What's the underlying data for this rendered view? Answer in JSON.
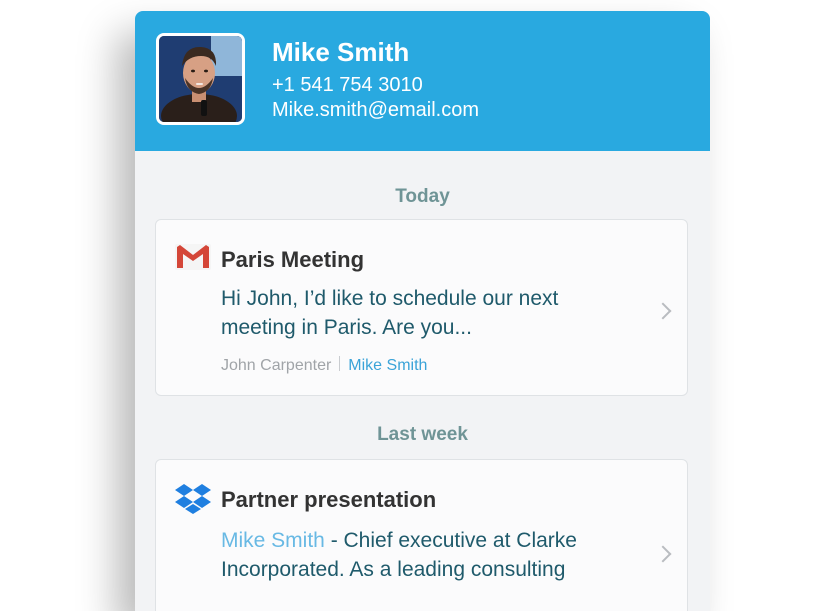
{
  "contact": {
    "name": "Mike Smith",
    "phone": "+1 541 754 3010",
    "email": "Mike.smith@email.com"
  },
  "sections": [
    {
      "label": "Today"
    },
    {
      "label": "Last week"
    }
  ],
  "cards": [
    {
      "icon": "gmail-icon",
      "title": "Paris Meeting",
      "body": "Hi John, I’d like to schedule our next meeting in Paris. Are you...",
      "from": "John Carpenter",
      "to": "Mike Smith"
    },
    {
      "icon": "dropbox-icon",
      "title": "Partner presentation",
      "body_link": "Mike Smith",
      "body_rest": " - Chief executive at Clarke Incorporated. As a leading consulting"
    }
  ],
  "colors": {
    "header": "#29a9e0",
    "link": "#3aa3d8",
    "section_label": "#6f9496",
    "body_text": "#1f5a6b"
  }
}
